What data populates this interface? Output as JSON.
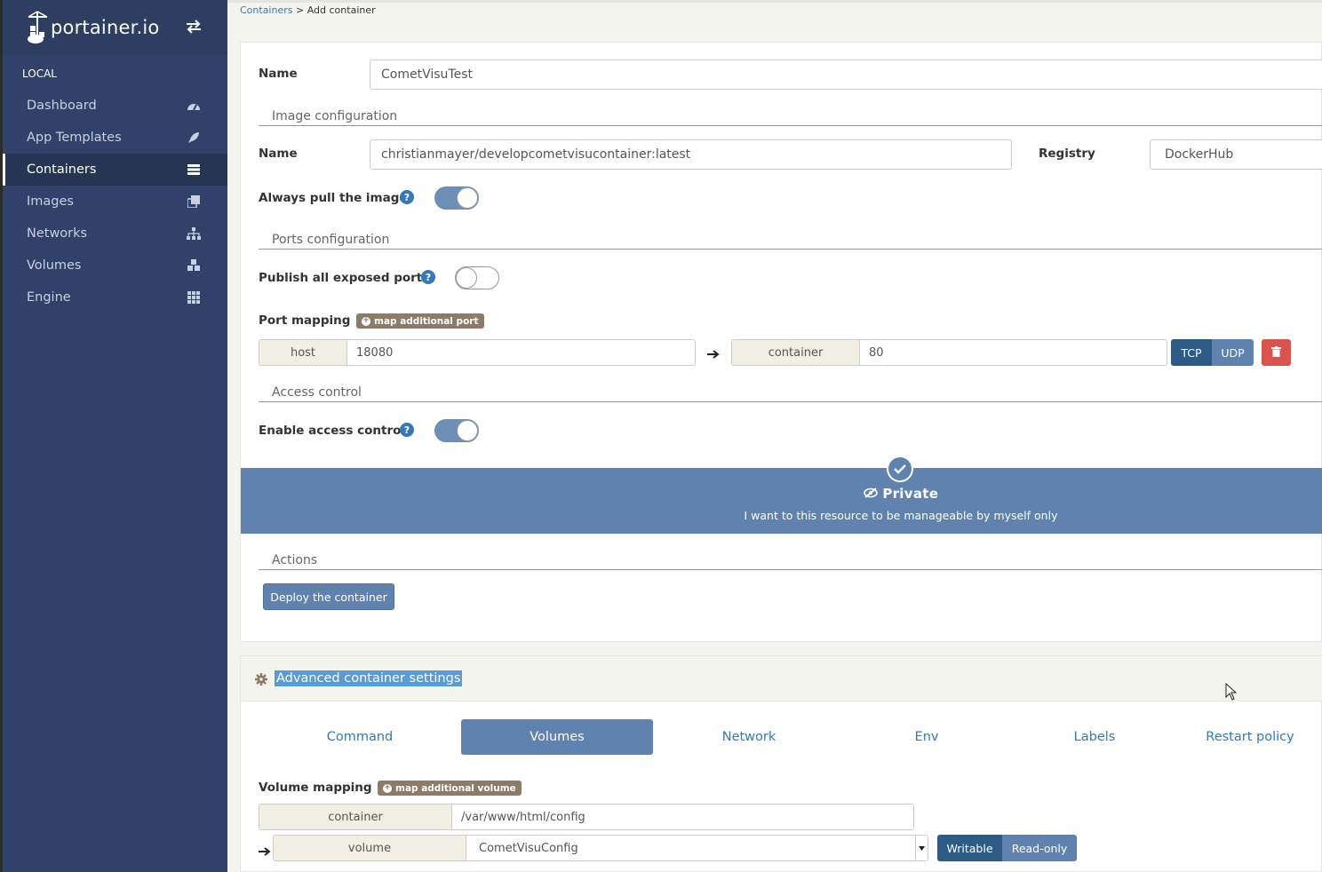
{
  "sidebar": {
    "brand": "portainer.io",
    "section": "LOCAL",
    "items": [
      {
        "label": "Dashboard",
        "icon": "dashboard-icon"
      },
      {
        "label": "App Templates",
        "icon": "rocket-icon"
      },
      {
        "label": "Containers",
        "icon": "server-icon",
        "active": true
      },
      {
        "label": "Images",
        "icon": "clone-icon"
      },
      {
        "label": "Networks",
        "icon": "sitemap-icon"
      },
      {
        "label": "Volumes",
        "icon": "cubes-icon"
      },
      {
        "label": "Engine",
        "icon": "th-icon"
      }
    ]
  },
  "breadcrumb": {
    "parent": "Containers",
    "separator": " > ",
    "current": "Add container"
  },
  "form": {
    "name_label": "Name",
    "name_value": "CometVisuTest",
    "image_config_legend": "Image configuration",
    "image_name_label": "Name",
    "image_name_value": "christianmayer/developcometvisucontainer:latest",
    "registry_label": "Registry",
    "registry_value": "DockerHub",
    "always_pull_label": "Always pull the image",
    "ports_legend": "Ports configuration",
    "publish_all_label": "Publish all exposed ports",
    "port_mapping_label": "Port mapping",
    "map_port_button": "map additional port",
    "host_addon": "host",
    "host_value": "18080",
    "container_addon": "container",
    "container_value": "80",
    "tcp_label": "TCP",
    "udp_label": "UDP",
    "access_legend": "Access control",
    "enable_access_label": "Enable access control",
    "private_title": "Private",
    "private_desc": "I want to this resource to be manageable by myself only",
    "actions_legend": "Actions",
    "deploy_button": "Deploy the container"
  },
  "advanced": {
    "title": "Advanced container settings",
    "tabs": [
      "Command",
      "Volumes",
      "Network",
      "Env",
      "Labels",
      "Restart policy"
    ],
    "active_tab": "Volumes",
    "volume_mapping_label": "Volume mapping",
    "map_volume_button": "map additional volume",
    "container_addon": "container",
    "container_path": "/var/www/html/config",
    "volume_addon": "volume",
    "volume_value": "CometVisuConfig",
    "writable_label": "Writable",
    "readonly_label": "Read-only"
  },
  "colors": {
    "sidebar": "#30426a",
    "primary": "#5f83ae",
    "link": "#337ab7",
    "danger": "#d9534f",
    "badge": "#8c7b66"
  }
}
